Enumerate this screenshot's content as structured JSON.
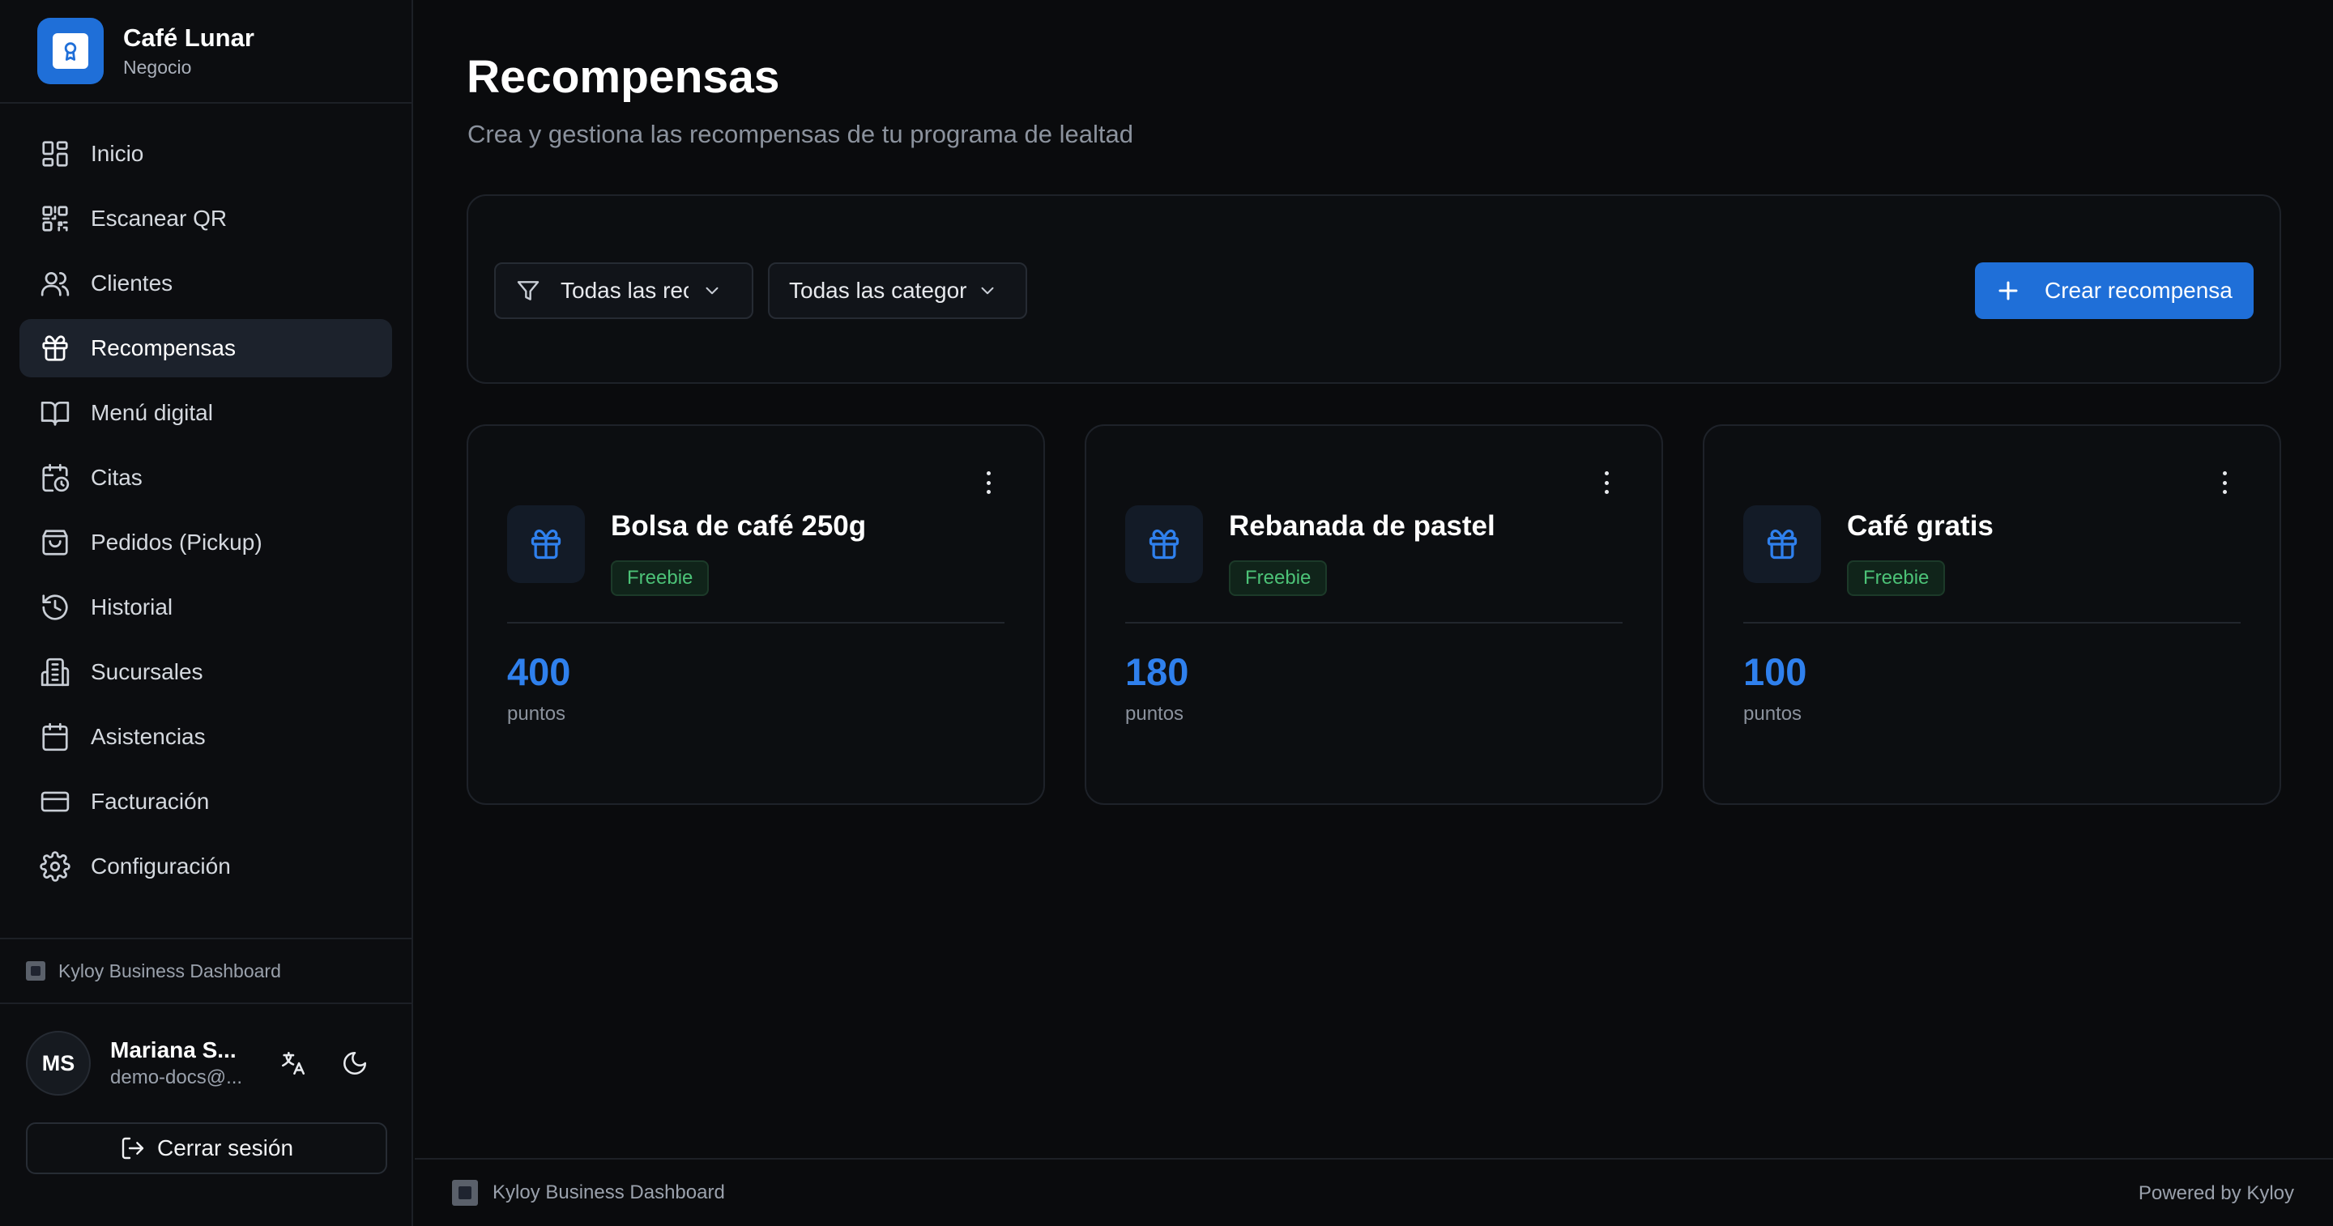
{
  "brand": {
    "name": "Café Lunar",
    "subtitle": "Negocio"
  },
  "sidebar": {
    "items": [
      {
        "label": "Inicio",
        "icon": "grid-icon",
        "active": false
      },
      {
        "label": "Escanear QR",
        "icon": "qr-icon",
        "active": false
      },
      {
        "label": "Clientes",
        "icon": "users-icon",
        "active": false
      },
      {
        "label": "Recompensas",
        "icon": "gift-icon",
        "active": true
      },
      {
        "label": "Menú digital",
        "icon": "book-icon",
        "active": false
      },
      {
        "label": "Citas",
        "icon": "calendar-clock-icon",
        "active": false
      },
      {
        "label": "Pedidos (Pickup)",
        "icon": "shopping-bag-icon",
        "active": false
      },
      {
        "label": "Historial",
        "icon": "history-icon",
        "active": false
      },
      {
        "label": "Sucursales",
        "icon": "building-icon",
        "active": false
      },
      {
        "label": "Asistencias",
        "icon": "calendar-icon",
        "active": false
      },
      {
        "label": "Facturación",
        "icon": "credit-card-icon",
        "active": false
      },
      {
        "label": "Configuración",
        "icon": "gear-icon",
        "active": false
      }
    ],
    "footer_brand": "Kyloy Business Dashboard"
  },
  "user": {
    "initials": "MS",
    "name": "Mariana S...",
    "email": "demo-docs@...",
    "logout_label": "Cerrar sesión"
  },
  "page": {
    "title": "Recompensas",
    "subtitle": "Crea y gestiona las recompensas de tu programa de lealtad"
  },
  "filters": {
    "status_value": "Todas las rec",
    "category_value": "Todas las categor",
    "create_label": "Crear recompensa"
  },
  "rewards": [
    {
      "title": "Bolsa de café 250g",
      "badge": "Freebie",
      "points": "400",
      "points_label": "puntos"
    },
    {
      "title": "Rebanada de pastel",
      "badge": "Freebie",
      "points": "180",
      "points_label": "puntos"
    },
    {
      "title": "Café gratis",
      "badge": "Freebie",
      "points": "100",
      "points_label": "puntos"
    }
  ],
  "footer": {
    "brand": "Kyloy Business Dashboard",
    "powered": "Powered by Kyloy"
  },
  "colors": {
    "accent": "#1f6fd8",
    "background": "#0a0b0d",
    "badge_green": "#4cc277"
  }
}
